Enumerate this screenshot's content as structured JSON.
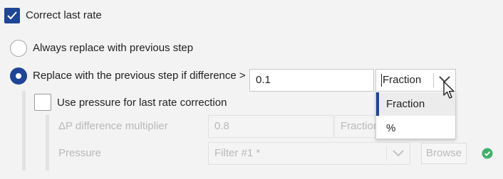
{
  "correct_last_rate": {
    "label": "Correct last rate",
    "checked": true
  },
  "options": {
    "always_replace": {
      "label": "Always replace with previous step",
      "selected": false
    },
    "replace_if_diff": {
      "label": "Replace with the previous step if difference >",
      "selected": true
    }
  },
  "difference": {
    "value": "0.1",
    "unit_selected": "Fraction"
  },
  "unit_dropdown": {
    "options": [
      "Fraction",
      "%"
    ],
    "highlighted": "Fraction"
  },
  "use_pressure": {
    "label": "Use pressure for last rate correction",
    "checked": false
  },
  "dp_multiplier": {
    "label": "ΔP difference multiplier",
    "value": "0.8",
    "unit": "Fraction"
  },
  "pressure": {
    "label": "Pressure",
    "value": "Filter #1 *",
    "browse_label": "Browse"
  },
  "colors": {
    "accent": "#1f4596",
    "status_ok": "#3fb069"
  },
  "icons": {
    "checkbox_check": "check-icon",
    "dropdown": "chevron-down-icon",
    "cursor": "mouse-pointer-icon",
    "status": "check-circle-icon"
  }
}
